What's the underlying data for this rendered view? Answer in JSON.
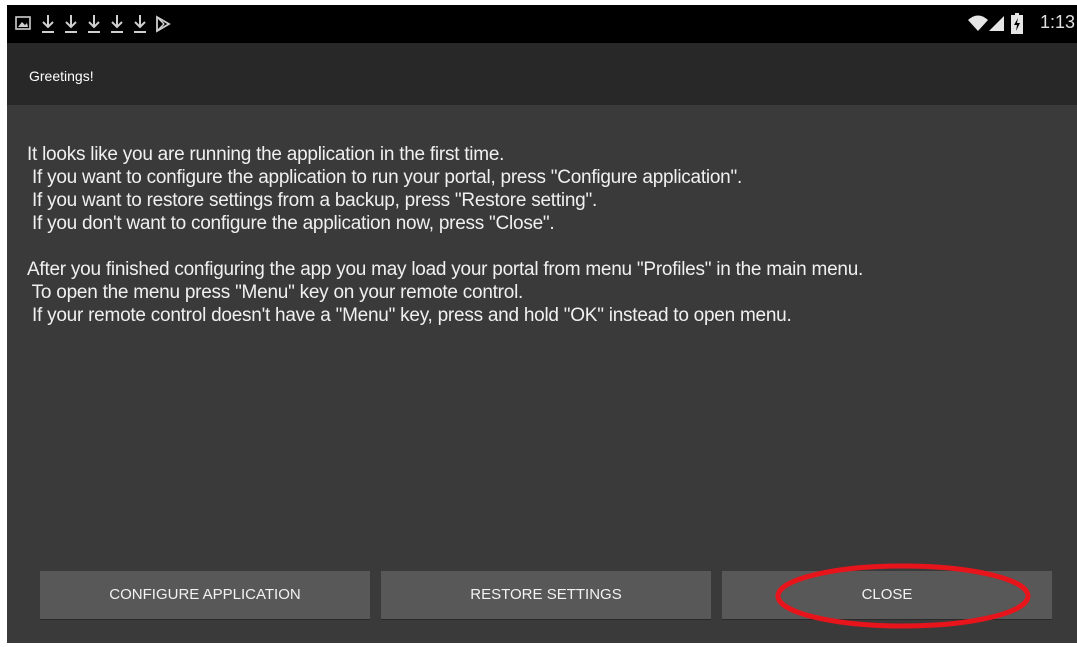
{
  "status_bar": {
    "left_icons": [
      "gallery-icon",
      "download-icon",
      "download-icon",
      "download-icon",
      "download-icon",
      "download-icon",
      "play-store-icon"
    ],
    "right_icons": [
      "wifi-icon",
      "signal-icon",
      "battery-charging-icon"
    ],
    "time": "1:13"
  },
  "dialog": {
    "title": "Greetings!",
    "message_lines": [
      "It looks like you are running the application in the first time.",
      " If you want to configure the application to run your portal, press \"Configure application\".",
      " If you want to restore settings from a backup, press \"Restore setting\".",
      " If you don't want to configure the application now, press \"Close\".",
      "",
      " After you finished configuring the app you may load your portal from menu \"Profiles\" in the main menu.",
      " To open the menu press \"Menu\" key on your remote control.",
      " If your remote control doesn't have a \"Menu\" key, press and hold \"OK\" instead to open menu."
    ],
    "buttons": {
      "configure": "CONFIGURE APPLICATION",
      "restore": "RESTORE SETTINGS",
      "close": "CLOSE"
    }
  },
  "colors": {
    "background": "#3a3a3a",
    "title_bar": "#282828",
    "button": "#585858",
    "highlight": "#e8141b"
  }
}
